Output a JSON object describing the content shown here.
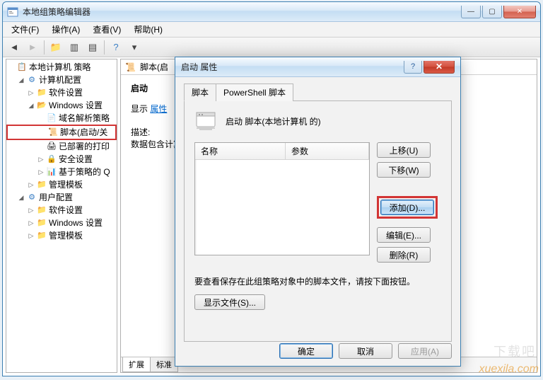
{
  "window": {
    "title": "本地组策略编辑器",
    "controls": {
      "min": "—",
      "max": "▢",
      "close": "✕"
    }
  },
  "menubar": {
    "file": "文件(F)",
    "action": "操作(A)",
    "view": "查看(V)",
    "help": "帮助(H)"
  },
  "tree": {
    "root": "本地计算机 策略",
    "computer_config": "计算机配置",
    "software_settings": "软件设置",
    "windows_settings": "Windows 设置",
    "name_resolution": "域名解析策略",
    "scripts_startup": "脚本(启动/关",
    "deployed_printers": "已部署的打印",
    "security_settings": "安全设置",
    "policy_based_qos": "基于策略的 Q",
    "admin_templates": "管理模板",
    "user_config": "用户配置",
    "user_software": "软件设置",
    "user_windows": "Windows 设置",
    "user_admin_templates": "管理模板"
  },
  "right_panel": {
    "header_title": "脚本(启",
    "section_title": "启动",
    "show_label": "显示",
    "properties_link": "属性",
    "desc_label": "描述:",
    "desc_text": "数据包含计算",
    "bottom_tab_extended": "扩展",
    "bottom_tab_standard": "标准"
  },
  "dialog": {
    "title": "启动 属性",
    "tabs": {
      "scripts": "脚本",
      "powershell": "PowerShell 脚本"
    },
    "headline": "启动 脚本(本地计算机 的)",
    "columns": {
      "name": "名称",
      "params": "参数"
    },
    "buttons": {
      "up": "上移(U)",
      "down": "下移(W)",
      "add": "添加(D)...",
      "edit": "编辑(E)...",
      "remove": "删除(R)"
    },
    "hint": "要查看保存在此组策略对象中的脚本文件，请按下面按钮。",
    "show_files": "显示文件(S)...",
    "ok": "确定",
    "cancel": "取消",
    "apply": "应用(A)"
  },
  "watermark": "xuexila.com",
  "watermark2": "下载吧"
}
